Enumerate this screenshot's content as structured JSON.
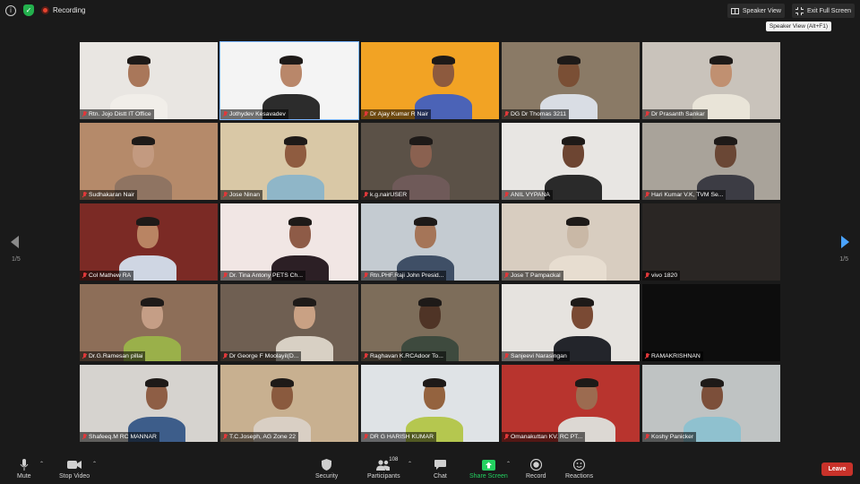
{
  "topbar": {
    "recording_label": "Recording",
    "speaker_view_label": "Speaker View",
    "exit_fullscreen_label": "Exit Full Screen",
    "tooltip": "Speaker View (Alt+F1)"
  },
  "pagination": {
    "left_indicator": "1/5",
    "right_indicator": "1/5"
  },
  "participants": [
    {
      "name": "Rtn. Jojo Distt IT Office",
      "bg": "#e9e6e2",
      "skin": "#a9775a",
      "shirt": "#f1eee9",
      "muted": true
    },
    {
      "name": "Jothydev Kesavadev",
      "bg": "#f4f4f4",
      "skin": "#b9876a",
      "shirt": "#2c2c2c",
      "muted": true,
      "active": true
    },
    {
      "name": "Dr Ajay Kumar R Nair",
      "bg": "#f2a324",
      "skin": "#8d5a3e",
      "shirt": "#4b63b7",
      "muted": true
    },
    {
      "name": "DG Dr Thomas 3211",
      "bg": "#8a7a66",
      "skin": "#7a4f35",
      "shirt": "#d9dde4",
      "muted": true
    },
    {
      "name": "Dr Prasanth Sankar",
      "bg": "#c9c3bb",
      "skin": "#c09071",
      "shirt": "#e9e4d8",
      "muted": true
    },
    {
      "name": "Sudhakaran Nair",
      "bg": "#b58a6a",
      "skin": "#c39a80",
      "shirt": "#8f7462",
      "muted": true
    },
    {
      "name": "Jose Ninan",
      "bg": "#d9c8a6",
      "skin": "#8f5c40",
      "shirt": "#8fb6c8",
      "muted": true
    },
    {
      "name": "k.g.nairUSER",
      "bg": "#5b5147",
      "skin": "#8a6150",
      "shirt": "#6f5a59",
      "muted": true
    },
    {
      "name": "ANIL VYPANA",
      "bg": "#e8e6e3",
      "skin": "#6d4532",
      "shirt": "#2a2a2a",
      "muted": true
    },
    {
      "name": "Hari Kumar V.K, TVM Se...",
      "bg": "#a9a39a",
      "skin": "#6a4735",
      "shirt": "#3c3c44",
      "muted": true
    },
    {
      "name": "Col Mathew RA",
      "bg": "#7b2a25",
      "skin": "#b98463",
      "shirt": "#cfd6e3",
      "muted": true
    },
    {
      "name": "Dr. Tina Antony PETS Ch...",
      "bg": "#f1e6e4",
      "skin": "#8e5b47",
      "shirt": "#2c1f25",
      "muted": true
    },
    {
      "name": "Rtn.PHF.Raji John Presid...",
      "bg": "#c4cbd1",
      "skin": "#a57558",
      "shirt": "#3f4f66",
      "muted": true
    },
    {
      "name": "Jose T Pampackal",
      "bg": "#d8cdc0",
      "skin": "#c9b8a6",
      "shirt": "#e7ddd0",
      "muted": true
    },
    {
      "name": "vivo 1820",
      "bg": "#2a2624",
      "skin": "#2a2624",
      "shirt": "#2a2624",
      "muted": true
    },
    {
      "name": "Dr.G.Ramesan pillai",
      "bg": "#8d6e58",
      "skin": "#c59e86",
      "shirt": "#9ab04a",
      "muted": true
    },
    {
      "name": "Dr George F Moolayil(D...",
      "bg": "#6f5f52",
      "skin": "#c9a184",
      "shirt": "#d8d0c4",
      "muted": true
    },
    {
      "name": "Raghavan K.RCAdoor To...",
      "bg": "#7d6d5a",
      "skin": "#4f3426",
      "shirt": "#3e4a3e",
      "muted": true
    },
    {
      "name": "Sanjeevi Narasingan",
      "bg": "#e6e3df",
      "skin": "#7a4a34",
      "shirt": "#23252b",
      "muted": true
    },
    {
      "name": "RAMAKRISHNAN",
      "bg": "#0d0d0d",
      "skin": "#0d0d0d",
      "shirt": "#0d0d0d",
      "muted": true
    },
    {
      "name": "Shafeeq.M RC MANNAR",
      "bg": "#d6d3cf",
      "skin": "#8e5e45",
      "shirt": "#3d5d8a",
      "muted": true
    },
    {
      "name": "T.C.Joseph, AG Zone 22",
      "bg": "#c8b090",
      "skin": "#8a5a3e",
      "shirt": "#d9cfc4",
      "muted": true
    },
    {
      "name": "DR G HARISH KUMAR",
      "bg": "#dfe3e6",
      "skin": "#94633f",
      "shirt": "#b5c74f",
      "muted": true
    },
    {
      "name": "Omanakuttan KV. RC PT...",
      "bg": "#b8342e",
      "skin": "#9c6b50",
      "shirt": "#dcd8d3",
      "muted": true
    },
    {
      "name": "Koshy Panicker",
      "bg": "#bfc3c3",
      "skin": "#7c4f3a",
      "shirt": "#8fc1cf",
      "muted": true
    }
  ],
  "toolbar": {
    "mute_label": "Mute",
    "stop_video_label": "Stop Video",
    "security_label": "Security",
    "participants_label": "Participants",
    "participants_count": "108",
    "chat_label": "Chat",
    "share_screen_label": "Share Screen",
    "record_label": "Record",
    "reactions_label": "Reactions",
    "leave_label": "Leave",
    "share_color": "#23d160",
    "leave_color": "#c8322a"
  }
}
